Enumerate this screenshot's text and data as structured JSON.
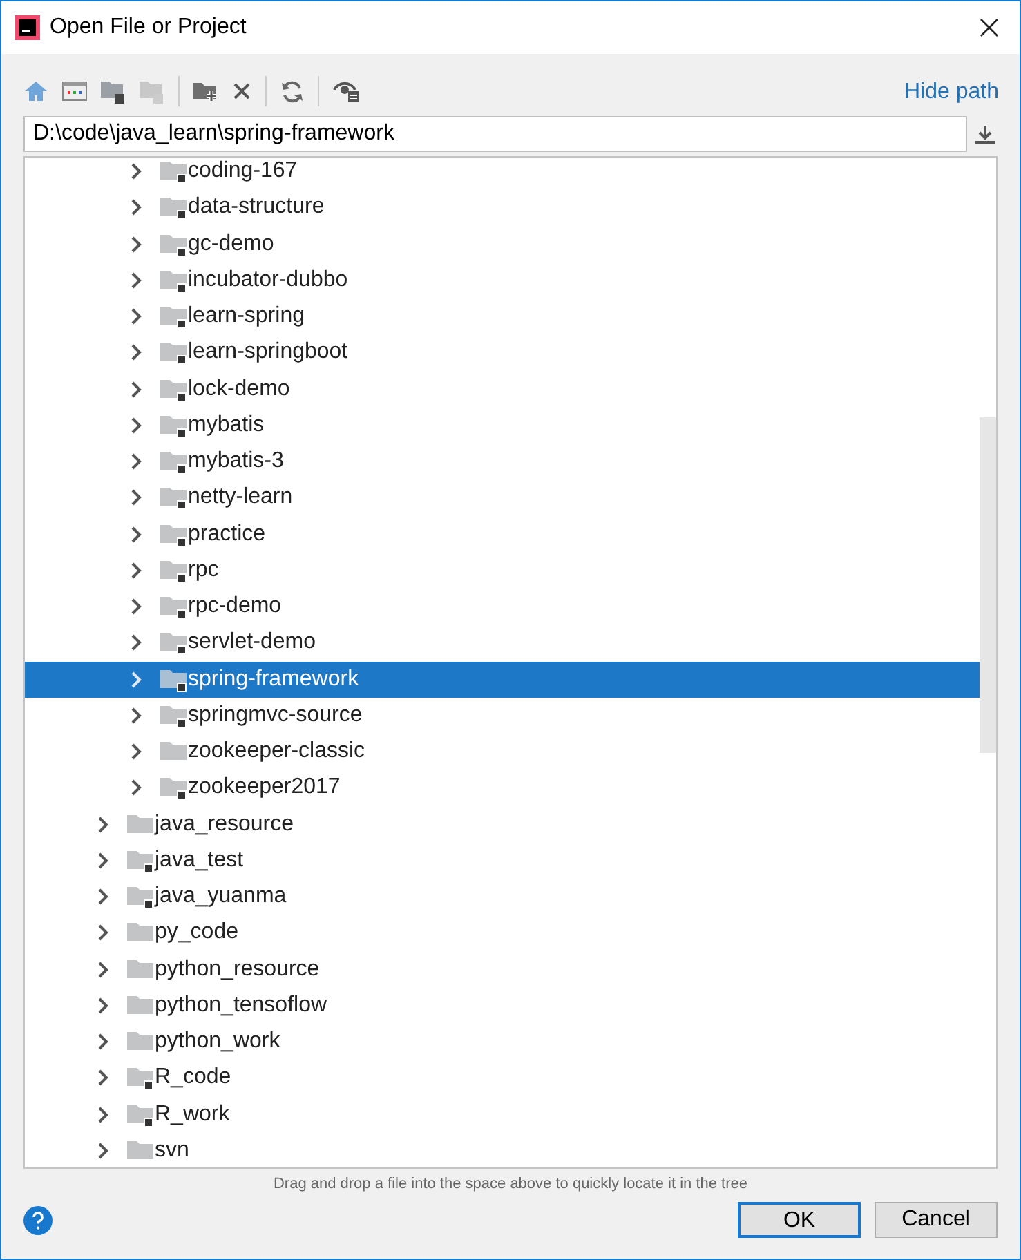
{
  "window": {
    "title": "Open File or Project"
  },
  "toolbar": {
    "link": "Hide path"
  },
  "path_field": {
    "value": "D:\\code\\java_learn\\spring-framework"
  },
  "tree": {
    "items": [
      {
        "children": [
          {
            "label": "coding-167",
            "module": true,
            "selected": false
          },
          {
            "label": "data-structure",
            "module": true,
            "selected": false
          },
          {
            "label": "gc-demo",
            "module": true,
            "selected": false
          },
          {
            "label": "incubator-dubbo",
            "module": true,
            "selected": false
          },
          {
            "label": "learn-spring",
            "module": true,
            "selected": false
          },
          {
            "label": "learn-springboot",
            "module": true,
            "selected": false
          },
          {
            "label": "lock-demo",
            "module": true,
            "selected": false
          },
          {
            "label": "mybatis",
            "module": true,
            "selected": false
          },
          {
            "label": "mybatis-3",
            "module": true,
            "selected": false
          },
          {
            "label": "netty-learn",
            "module": true,
            "selected": false
          },
          {
            "label": "practice",
            "module": true,
            "selected": false
          },
          {
            "label": "rpc",
            "module": true,
            "selected": false
          },
          {
            "label": "rpc-demo",
            "module": true,
            "selected": false
          },
          {
            "label": "servlet-demo",
            "module": true,
            "selected": false
          },
          {
            "label": "spring-framework",
            "module": true,
            "selected": true
          },
          {
            "label": "springmvc-source",
            "module": true,
            "selected": false
          },
          {
            "label": "zookeeper-classic",
            "module": false,
            "selected": false
          },
          {
            "label": "zookeeper2017",
            "module": true,
            "selected": false
          }
        ]
      },
      {
        "label": "java_resource",
        "module": false,
        "selected": false
      },
      {
        "label": "java_test",
        "module": true,
        "selected": false
      },
      {
        "label": "java_yuanma",
        "module": true,
        "selected": false
      },
      {
        "label": "py_code",
        "module": false,
        "selected": false
      },
      {
        "label": "python_resource",
        "module": false,
        "selected": false
      },
      {
        "label": "python_tensoflow",
        "module": false,
        "selected": false
      },
      {
        "label": "python_work",
        "module": false,
        "selected": false
      },
      {
        "label": "R_code",
        "module": true,
        "selected": false
      },
      {
        "label": "R_work",
        "module": true,
        "selected": false
      },
      {
        "label": "svn",
        "module": false,
        "selected": false
      }
    ]
  },
  "hint": "Drag and drop a file into the space above to quickly locate it in the tree",
  "buttons": [
    {
      "label": "OK",
      "default": true
    },
    {
      "label": "Cancel",
      "default": false
    }
  ]
}
